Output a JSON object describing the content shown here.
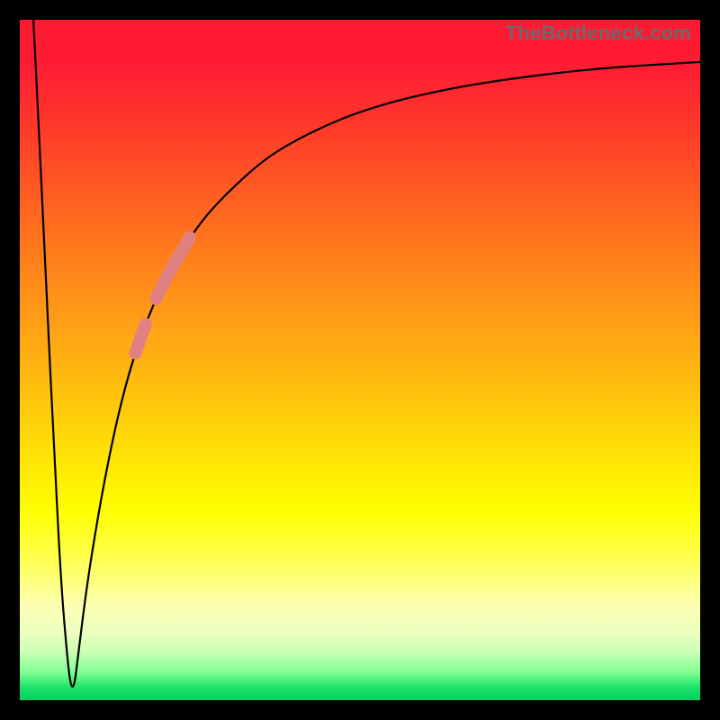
{
  "attribution": "TheBottleneck.com",
  "colors": {
    "marker": "#e08080",
    "curve": "#000000",
    "background_top": "#ff1a34",
    "background_bottom": "#00d060"
  },
  "chart_data": {
    "type": "line",
    "title": "",
    "xlabel": "",
    "ylabel": "",
    "xlim": [
      0,
      100
    ],
    "ylim": [
      0,
      100
    ],
    "grid": false,
    "series": [
      {
        "name": "bottleneck-curve",
        "x": [
          2,
          3,
          4,
          5,
          6,
          7,
          7.5,
          8,
          8.5,
          10,
          12,
          14,
          16,
          18,
          20,
          22,
          25,
          28,
          32,
          36,
          40,
          45,
          50,
          55,
          60,
          65,
          70,
          75,
          80,
          85,
          90,
          95,
          100
        ],
        "y": [
          100,
          80,
          58,
          38,
          18,
          6,
          2,
          2,
          6,
          18,
          30,
          40,
          48,
          54,
          59,
          63,
          68,
          72,
          76,
          79.5,
          82,
          84.5,
          86.5,
          88,
          89.2,
          90.2,
          91,
          91.7,
          92.3,
          92.8,
          93.2,
          93.5,
          93.8
        ]
      }
    ],
    "markers": [
      {
        "name": "highlight-segment-upper",
        "x_range": [
          20,
          25
        ],
        "shape": "capsule"
      },
      {
        "name": "highlight-segment-lower",
        "x_range": [
          17,
          18.5
        ],
        "shape": "capsule"
      }
    ],
    "optimum_x": 7.8
  }
}
